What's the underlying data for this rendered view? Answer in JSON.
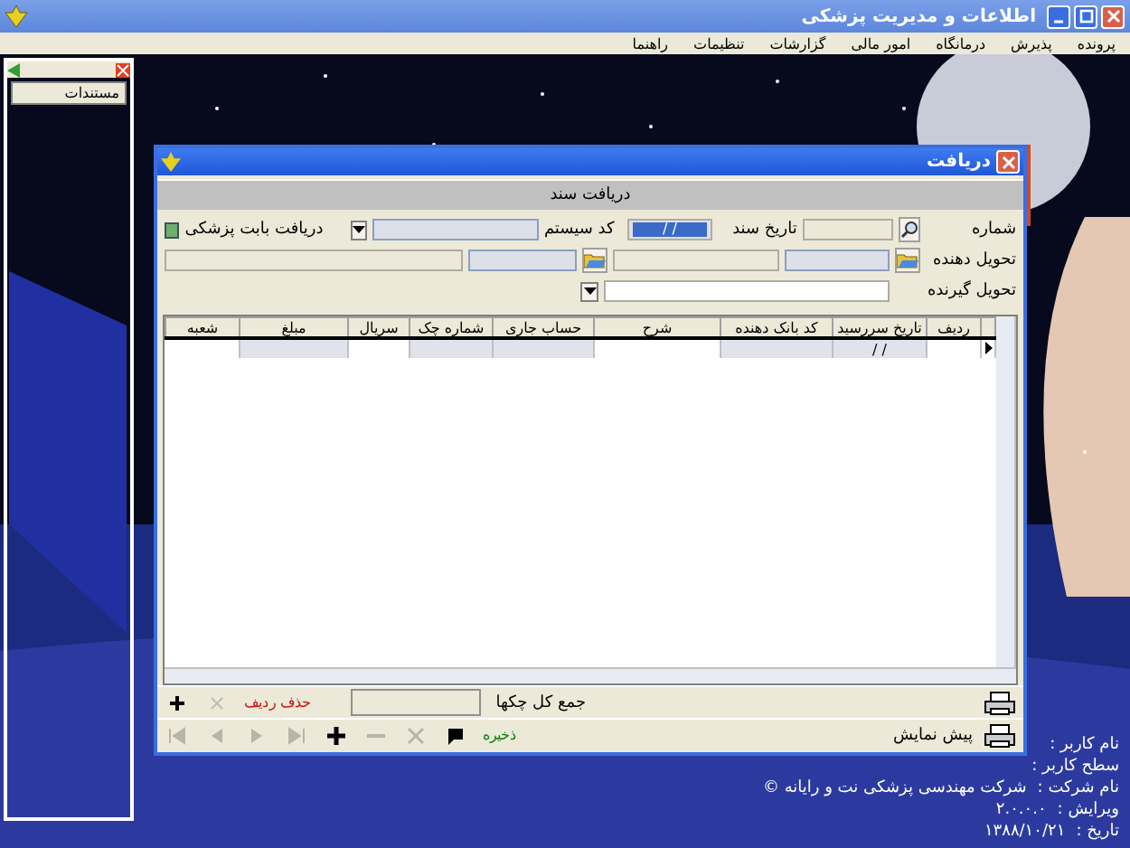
{
  "window": {
    "title": "اطلاعات و مدیریت پزشکی"
  },
  "menu": [
    "پرونده",
    "پذیرش",
    "درمانگاه",
    "امور مالی",
    "گزارشات",
    "تنظیمات",
    "راهنما"
  ],
  "side_panel": {
    "title": "مستندات"
  },
  "dialog": {
    "title": "دریافت",
    "header": "دریافت سند",
    "form": {
      "number_label": "شماره",
      "date_label": "تاریخ سند",
      "date_value": "/ /",
      "date_selected": true,
      "system_label": "کد سیستم",
      "check_label": "دریافت بابت پزشکی",
      "checked": true,
      "giver_label": "تحویل دهنده",
      "receiver_label": "تحویل گیرنده"
    },
    "table": {
      "columns": [
        {
          "label": "ردیف",
          "shaded": false
        },
        {
          "label": "تاریخ سررسید",
          "shaded": true
        },
        {
          "label": "کد بانک دهنده",
          "shaded": true
        },
        {
          "label": "شرح",
          "shaded": false
        },
        {
          "label": "حساب جاری",
          "shaded": true
        },
        {
          "label": "شماره چک",
          "shaded": true
        },
        {
          "label": "سریال",
          "shaded": false
        },
        {
          "label": "مبلغ",
          "shaded": true
        },
        {
          "label": "شعبه",
          "shaded": false
        }
      ],
      "rows": [
        {
          "current": true,
          "cells": [
            "",
            "/ /",
            "",
            "",
            "",
            "",
            "",
            "",
            ""
          ]
        }
      ]
    },
    "total_label": "جمع کل چکها",
    "delete_row": "حذف ردیف",
    "save": "ذخیره",
    "preview": "پیش نمایش",
    "nav": [
      {
        "kind": "first",
        "disabled": true
      },
      {
        "kind": "prev",
        "disabled": true
      },
      {
        "kind": "next",
        "disabled": true
      },
      {
        "kind": "last",
        "disabled": true
      },
      {
        "kind": "add",
        "disabled": false
      },
      {
        "kind": "remove",
        "disabled": true
      },
      {
        "kind": "cancel",
        "disabled": true
      },
      {
        "kind": "post",
        "disabled": false
      }
    ]
  },
  "info": [
    {
      "label": "نام کاربر :"
    },
    {
      "label": "سطح کاربر :"
    },
    {
      "label": "نام شرکت :",
      "value": "شرکت مهندسی پزشکی نت و رایانه ©"
    },
    {
      "label": "ویرایش :",
      "value": "۲.۰.۰.۰"
    },
    {
      "label": "تاریخ :",
      "value": "۱۳۸۸/۱۰/۲۱"
    }
  ]
}
